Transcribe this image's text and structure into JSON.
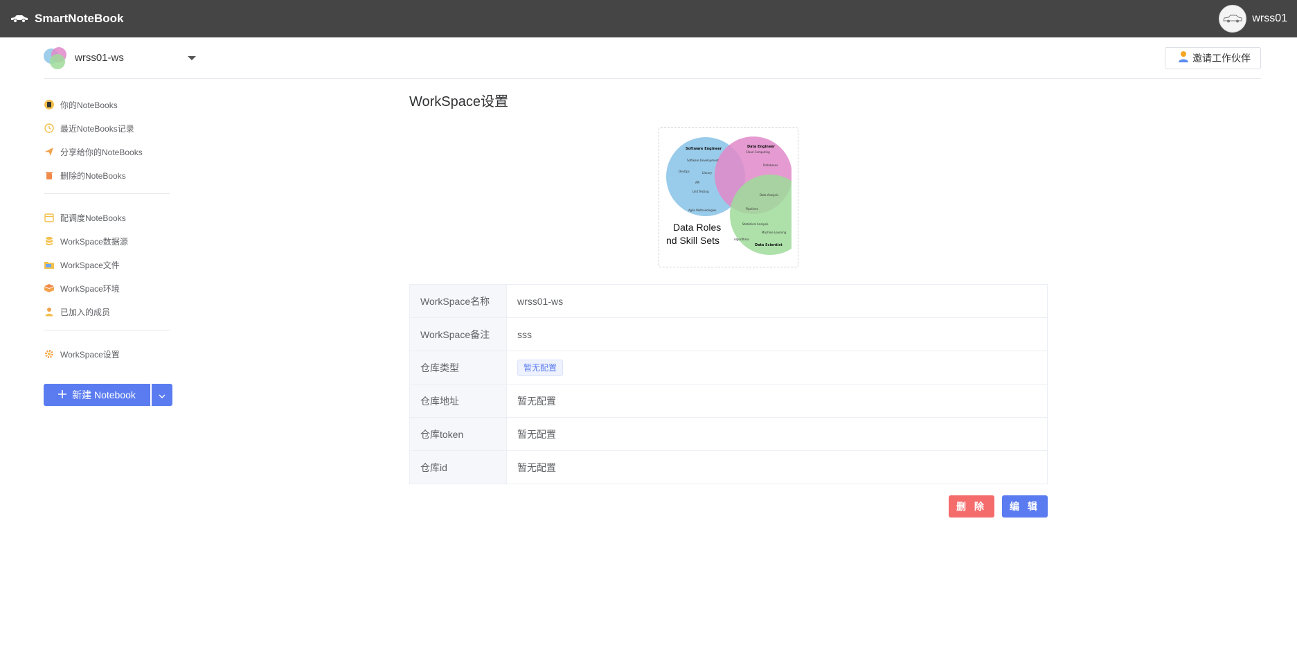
{
  "topbar": {
    "app_name": "SmartNoteBook",
    "username": "wrss01",
    "logo_icon": "car-icon",
    "bg_color": "#454545"
  },
  "workspace_header": {
    "workspace_name": "wrss01-ws",
    "invite_label": "邀请工作伙伴"
  },
  "sidebar": {
    "group1": [
      {
        "label": "你的NoteBooks",
        "icon": "notebook-icon"
      },
      {
        "label": "最近NoteBooks记录",
        "icon": "clock-icon"
      },
      {
        "label": "分享给你的NoteBooks",
        "icon": "share-plane-icon"
      },
      {
        "label": "删除的NoteBooks",
        "icon": "trash-icon"
      }
    ],
    "group2": [
      {
        "label": "配调度NoteBooks",
        "icon": "calendar-icon"
      },
      {
        "label": "WorkSpace数据源",
        "icon": "database-icon"
      },
      {
        "label": "WorkSpace文件",
        "icon": "folder-icon"
      },
      {
        "label": "WorkSpace环境",
        "icon": "box-icon"
      },
      {
        "label": "已加入的成员",
        "icon": "member-icon"
      }
    ],
    "group3": [
      {
        "label": "WorkSpace设置",
        "icon": "gear-icon"
      }
    ],
    "new_notebook_label": "新建 Notebook"
  },
  "main": {
    "title": "WorkSpace设置",
    "cover": {
      "line1": "Data Roles",
      "line2": "nd Skill Sets",
      "circle1": "Software Engineer",
      "circle2": "Data Engineer",
      "circle3": "Data Scientist"
    },
    "rows": [
      {
        "label": "WorkSpace名称",
        "value": "wrss01-ws"
      },
      {
        "label": "WorkSpace备注",
        "value": "sss"
      },
      {
        "label": "仓库类型",
        "value": "暂无配置"
      },
      {
        "label": "仓库地址",
        "value": "暂无配置"
      },
      {
        "label": "仓库token",
        "value": "暂无配置"
      },
      {
        "label": "仓库id",
        "value": "暂无配置"
      }
    ],
    "delete_label": "删 除",
    "edit_label": "编 辑"
  },
  "colors": {
    "accent": "#5b7cf0",
    "danger": "#f56c6c"
  }
}
